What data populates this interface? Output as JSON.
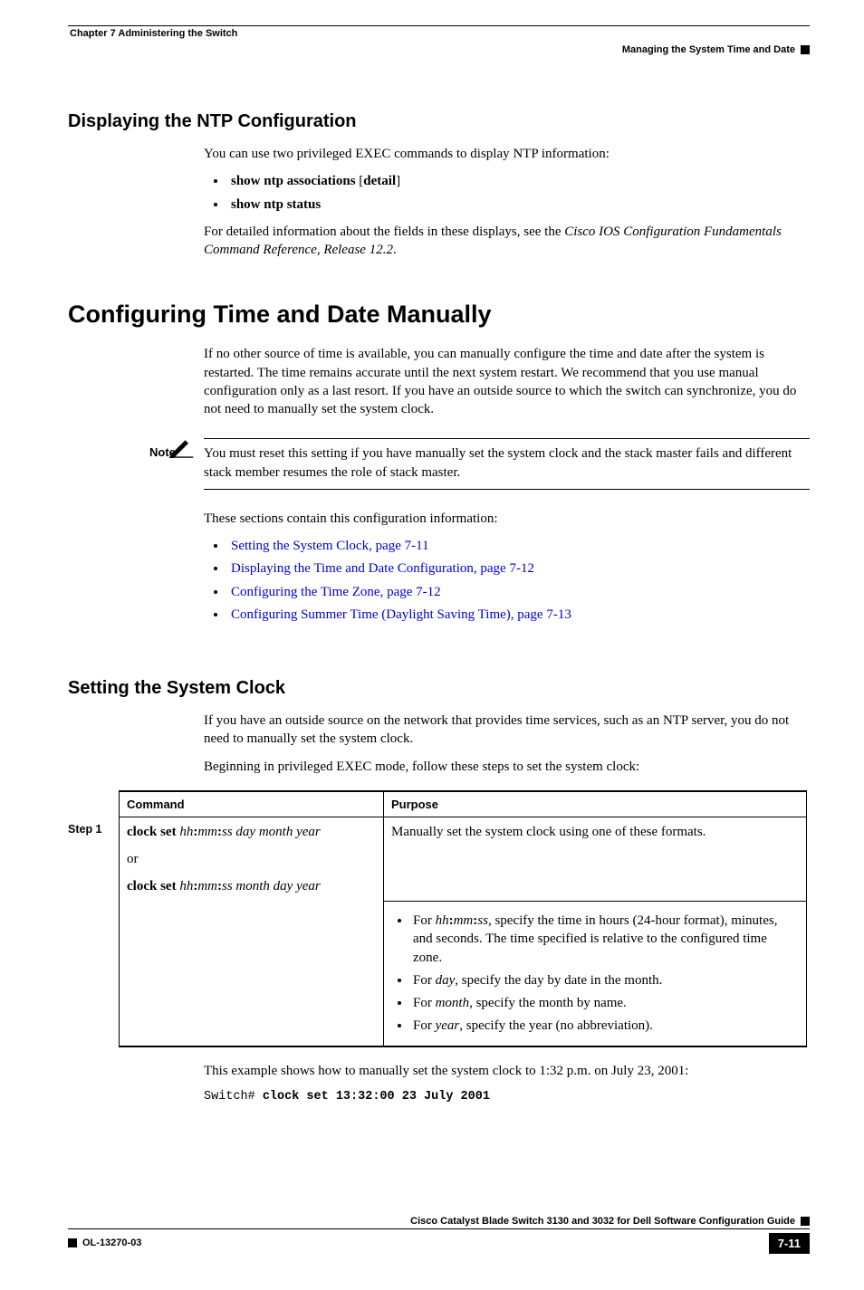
{
  "header": {
    "chapter": "Chapter 7      Administering the Switch",
    "section": "Managing the System Time and Date"
  },
  "sec1": {
    "title": "Displaying the NTP Configuration",
    "intro": "You can use two privileged EXEC commands to display NTP information:",
    "b1a": "show ntp associations",
    "b1b": " [",
    "b1c": "detail",
    "b1d": "]",
    "b2": "show ntp status",
    "p2a": "For detailed information about the fields in these displays, see the ",
    "p2b": "Cisco IOS Configuration Fundamentals Command Reference, Release 12.2",
    "p2c": "."
  },
  "sec2": {
    "title": "Configuring Time and Date Manually",
    "p1": "If no other source of time is available, you can manually configure the time and date after the system is restarted. The time remains accurate until the next system restart. We recommend that you use manual configuration only as a last resort. If you have an outside source to which the switch can synchronize, you do not need to manually set the system clock.",
    "note_label": "Note",
    "note": "You must reset this setting if you have manually set the system clock and the stack master fails and different stack member resumes the role of stack master.",
    "p2": "These sections contain this configuration information:",
    "links": {
      "l1": "Setting the System Clock, page 7-11",
      "l2": "Displaying the Time and Date Configuration, page 7-12",
      "l3": "Configuring the Time Zone, page 7-12",
      "l4": "Configuring Summer Time (Daylight Saving Time), page 7-13"
    }
  },
  "sec3": {
    "title": "Setting the System Clock",
    "p1": "If you have an outside source on the network that provides time services, such as an NTP server, you do not need to manually set the system clock.",
    "p2": "Beginning in privileged EXEC mode, follow these steps to set the system clock:",
    "table": {
      "h1": "Command",
      "h2": "Purpose",
      "step": "Step 1",
      "cmd": {
        "cs1": "clock set ",
        "arg1": "hh",
        "c1": ":",
        "arg2": "mm",
        "c2": ":",
        "arg3": "ss day month year",
        "or": "or",
        "cs2": "clock set ",
        "arg4": "hh",
        "c3": ":",
        "arg5": "mm",
        "c4": ":",
        "arg6": "ss month day year"
      },
      "purpose": {
        "intro": "Manually set the system clock using one of these formats.",
        "b1a": "For ",
        "b1b": "hh",
        "b1c": ":",
        "b1d": "mm",
        "b1e": ":",
        "b1f": "ss",
        "b1g": ", specify the time in hours (24-hour format), minutes, and seconds. The time specified is relative to the configured time zone.",
        "b2a": "For ",
        "b2b": "day",
        "b2c": ", specify the day by date in the month.",
        "b3a": "For ",
        "b3b": "month",
        "b3c": ", specify the month by name.",
        "b4a": "For ",
        "b4b": "year",
        "b4c": ", specify the year (no abbreviation)."
      }
    },
    "example": "This example shows how to manually set the system clock to 1:32 p.m. on July 23, 2001:",
    "code_prompt": "Switch# ",
    "code_cmd": "clock set 13:32:00 23 July 2001"
  },
  "footer": {
    "guide": "Cisco Catalyst Blade Switch 3130 and 3032 for Dell Software Configuration Guide",
    "doc": "OL-13270-03",
    "page": "7-11"
  }
}
